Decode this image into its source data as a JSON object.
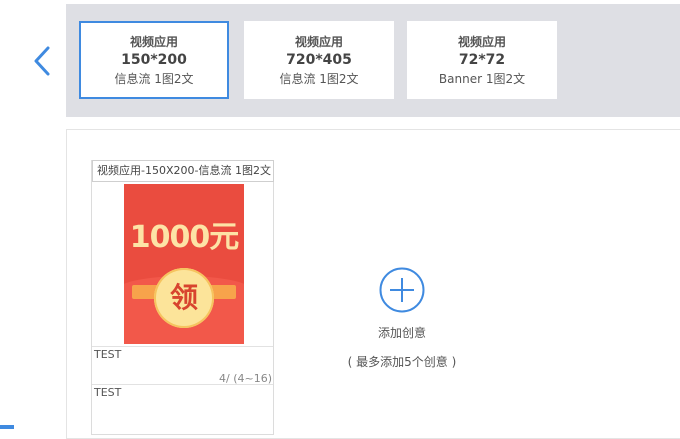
{
  "format_cards": [
    {
      "title": "视频应用",
      "size": "150*200",
      "desc": "信息流 1图2文"
    },
    {
      "title": "视频应用",
      "size": "720*405",
      "desc": "信息流 1图2文"
    },
    {
      "title": "视频应用",
      "size": "72*72",
      "desc": "Banner 1图2文"
    }
  ],
  "creative": {
    "name": "视频应用-150X200-信息流 1图2文",
    "image_amount_text": "1000元",
    "image_coin_text": "领",
    "text1": "TEST",
    "text1_counter": "4/ (4~16)",
    "text2": "TEST"
  },
  "add_creative": {
    "label": "添加创意",
    "hint": "( 最多添加5个创意 )"
  },
  "icons": {
    "back": "chevron-left-icon",
    "add": "plus-circle-icon"
  },
  "colors": {
    "accent": "#3f8ae0",
    "strip_bg": "#dedfe4",
    "packet_red": "#ea4c3f"
  }
}
